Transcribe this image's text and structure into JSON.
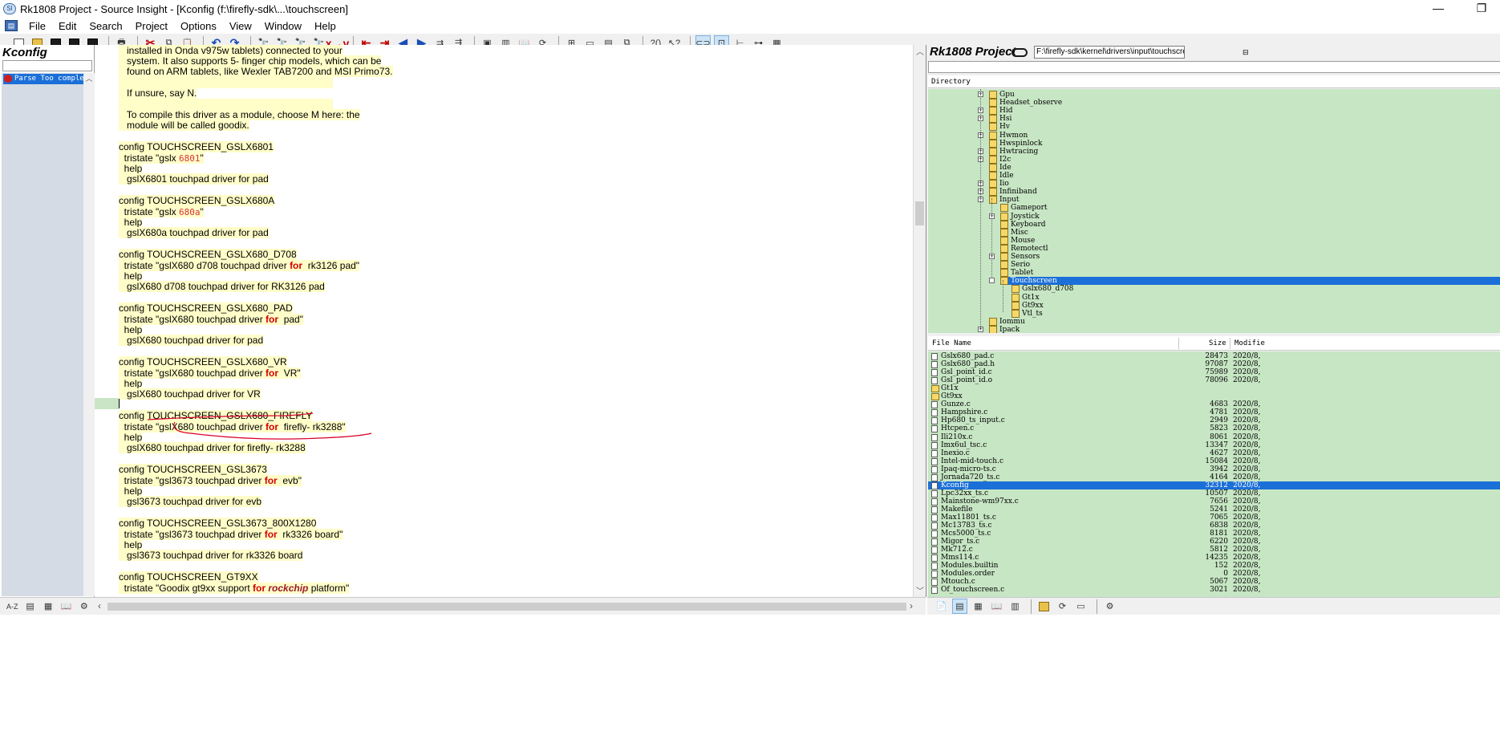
{
  "window": {
    "title": "Rk1808 Project - Source Insight - [Kconfig (f:\\firefly-sdk\\...\\touchscreen]",
    "minimize": "—",
    "restore": "❐"
  },
  "menu": [
    {
      "label": "File"
    },
    {
      "label": "Edit"
    },
    {
      "label": "Search"
    },
    {
      "label": "Project"
    },
    {
      "label": "Options"
    },
    {
      "label": "View"
    },
    {
      "label": "Window"
    },
    {
      "label": "Help"
    }
  ],
  "left_panel": {
    "title": "Kconfig",
    "item": "Parse Too complex"
  },
  "bottom_left": {
    "sort_az": "A-Z"
  },
  "code": [
    {
      "text": "   installed in Onda v975w tablets) connected to your",
      "hl": true
    },
    {
      "text": "   system. It also supports 5- finger chip models, which can be",
      "hl": true
    },
    {
      "text": "   found on ARM tablets, like Wexler TAB7200 and MSI Primo73.",
      "hl": true
    },
    {
      "text": "",
      "hl": true
    },
    {
      "text": "   If unsure, say N.",
      "hl": true
    },
    {
      "text": "",
      "hl": true
    },
    {
      "text": "   To compile this driver as a module, choose M here: the",
      "hl": true
    },
    {
      "text": "   module will be called goodix.",
      "hl": true
    },
    {
      "text": "",
      "hl": false
    },
    {
      "text": "config TOUCHSCREEN_GSLX6801",
      "hl": true
    },
    {
      "text": "  tristate \"gslx ",
      "num": "6801",
      "after": "\"",
      "hl": true
    },
    {
      "text": "  help",
      "hl": true
    },
    {
      "text": "   gslX6801 touchpad driver for pad",
      "hl": true
    },
    {
      "text": "",
      "hl": false
    },
    {
      "text": "config TOUCHSCREEN_GSLX680A",
      "hl": true
    },
    {
      "text": "  tristate \"gslx ",
      "num": "680a",
      "after": "\"",
      "hl": true
    },
    {
      "text": "  help",
      "hl": true
    },
    {
      "text": "   gslX680a touchpad driver for pad",
      "hl": true
    },
    {
      "text": "",
      "hl": false
    },
    {
      "text": "config TOUCHSCREEN_GSLX680_D708",
      "hl": true
    },
    {
      "text": "  tristate \"gslX680 d708 touchpad driver ",
      "kw": "for",
      "after": " rk3126 pad\"",
      "hl": true
    },
    {
      "text": "  help",
      "hl": true
    },
    {
      "text": "   gslX680 d708 touchpad driver for RK3126 pad",
      "hl": true
    },
    {
      "text": "",
      "hl": false
    },
    {
      "text": "config TOUCHSCREEN_GSLX680_PAD",
      "hl": true
    },
    {
      "text": "  tristate \"gslX680 touchpad driver ",
      "kw": "for",
      "after": " pad\"",
      "hl": true
    },
    {
      "text": "  help",
      "hl": true
    },
    {
      "text": "   gslX680 touchpad driver for pad",
      "hl": true
    },
    {
      "text": "",
      "hl": false
    },
    {
      "text": "config TOUCHSCREEN_GSLX680_VR",
      "hl": true
    },
    {
      "text": "  tristate \"gslX680 touchpad driver ",
      "kw": "for",
      "after": " VR\"",
      "hl": true
    },
    {
      "text": "  help",
      "hl": true
    },
    {
      "text": "   gslX680 touchpad driver for VR",
      "hl": true
    },
    {
      "text": "",
      "hl": false
    },
    {
      "text": "config TOUCHSCREEN_GSLX680_FIREFLY",
      "hl": true
    },
    {
      "text": "  tristate \"gslX680 touchpad driver ",
      "kw": "for",
      "after": " firefly- rk3288\"",
      "hl": true
    },
    {
      "text": "  help",
      "hl": true
    },
    {
      "text": "   gslX680 touchpad driver for firefly- rk3288",
      "hl": true
    },
    {
      "text": "",
      "hl": false
    },
    {
      "text": "config TOUCHSCREEN_GSL3673",
      "hl": true
    },
    {
      "text": "  tristate \"gsl3673 touchpad driver ",
      "kw": "for",
      "after": " evb\"",
      "hl": true
    },
    {
      "text": "  help",
      "hl": true
    },
    {
      "text": "   gsl3673 touchpad driver for evb",
      "hl": true
    },
    {
      "text": "",
      "hl": false
    },
    {
      "text": "config TOUCHSCREEN_GSL3673_800X1280",
      "hl": true
    },
    {
      "text": "  tristate \"gsl3673 touchpad driver ",
      "kw": "for",
      "after": " rk3326 board\"",
      "hl": true
    },
    {
      "text": "  help",
      "hl": true
    },
    {
      "text": "   gsl3673 touchpad driver for rk3326 board",
      "hl": true
    },
    {
      "text": "",
      "hl": false
    },
    {
      "text": "config TOUCHSCREEN_GT9XX",
      "hl": true
    },
    {
      "text": "  tristate \"Goodix gt9xx support ",
      "kw": "for",
      "rock": "rockchip",
      "after": " platform\"",
      "hl": true
    }
  ],
  "project": {
    "title": "Rk1808 Project",
    "path": "F:\\firefly-sdk\\kernel\\drivers\\input\\touchscreen",
    "dir_header": "Directory",
    "tree": [
      {
        "label": "Gpu",
        "depth": 0,
        "pm": "+"
      },
      {
        "label": "Headset_observe",
        "depth": 0,
        "pm": ""
      },
      {
        "label": "Hid",
        "depth": 0,
        "pm": "+"
      },
      {
        "label": "Hsi",
        "depth": 0,
        "pm": "+"
      },
      {
        "label": "Hv",
        "depth": 0,
        "pm": ""
      },
      {
        "label": "Hwmon",
        "depth": 0,
        "pm": "+"
      },
      {
        "label": "Hwspinlock",
        "depth": 0,
        "pm": ""
      },
      {
        "label": "Hwtracing",
        "depth": 0,
        "pm": "+"
      },
      {
        "label": "I2c",
        "depth": 0,
        "pm": "+"
      },
      {
        "label": "Ide",
        "depth": 0,
        "pm": ""
      },
      {
        "label": "Idle",
        "depth": 0,
        "pm": ""
      },
      {
        "label": "Iio",
        "depth": 0,
        "pm": "+"
      },
      {
        "label": "Infiniband",
        "depth": 0,
        "pm": "+"
      },
      {
        "label": "Input",
        "depth": 0,
        "pm": "−"
      },
      {
        "label": "Gameport",
        "depth": 1,
        "pm": ""
      },
      {
        "label": "Joystick",
        "depth": 1,
        "pm": "+"
      },
      {
        "label": "Keyboard",
        "depth": 1,
        "pm": ""
      },
      {
        "label": "Misc",
        "depth": 1,
        "pm": ""
      },
      {
        "label": "Mouse",
        "depth": 1,
        "pm": ""
      },
      {
        "label": "Remotectl",
        "depth": 1,
        "pm": ""
      },
      {
        "label": "Sensors",
        "depth": 1,
        "pm": "+"
      },
      {
        "label": "Serio",
        "depth": 1,
        "pm": ""
      },
      {
        "label": "Tablet",
        "depth": 1,
        "pm": ""
      },
      {
        "label": "Touchscreen",
        "depth": 1,
        "pm": "−",
        "selected": true
      },
      {
        "label": "Gslx680_d708",
        "depth": 2,
        "pm": ""
      },
      {
        "label": "Gt1x",
        "depth": 2,
        "pm": ""
      },
      {
        "label": "Gt9xx",
        "depth": 2,
        "pm": ""
      },
      {
        "label": "Vtl_ts",
        "depth": 2,
        "pm": ""
      },
      {
        "label": "Iommu",
        "depth": 0,
        "pm": ""
      },
      {
        "label": "Ipack",
        "depth": 0,
        "pm": "+"
      }
    ],
    "file_header": {
      "name": "File Name",
      "size": "Size",
      "modified": "Modifie"
    },
    "files": [
      {
        "name": "Gslx680_pad.c",
        "size": "28473",
        "date": "2020/8,"
      },
      {
        "name": "Gslx680_pad.h",
        "size": "97087",
        "date": "2020/8,"
      },
      {
        "name": "Gsl_point_id.c",
        "size": "75989",
        "date": "2020/8,"
      },
      {
        "name": "Gsl_point_id.o",
        "size": "78096",
        "date": "2020/8,"
      },
      {
        "name": "Gt1x",
        "size": "",
        "date": "",
        "folder": true
      },
      {
        "name": "Gt9xx",
        "size": "",
        "date": "",
        "folder": true
      },
      {
        "name": "Gunze.c",
        "size": "4683",
        "date": "2020/8,"
      },
      {
        "name": "Hampshire.c",
        "size": "4781",
        "date": "2020/8,"
      },
      {
        "name": "Hp680_ts_input.c",
        "size": "2949",
        "date": "2020/8,"
      },
      {
        "name": "Htcpen.c",
        "size": "5823",
        "date": "2020/8,"
      },
      {
        "name": "Ili210x.c",
        "size": "8061",
        "date": "2020/8,"
      },
      {
        "name": "Imx6ul_tsc.c",
        "size": "13347",
        "date": "2020/8,"
      },
      {
        "name": "Inexio.c",
        "size": "4627",
        "date": "2020/8,"
      },
      {
        "name": "Intel-mid-touch.c",
        "size": "15084",
        "date": "2020/8,"
      },
      {
        "name": "Ipaq-micro-ts.c",
        "size": "3942",
        "date": "2020/8,"
      },
      {
        "name": "Jornada720_ts.c",
        "size": "4164",
        "date": "2020/8,"
      },
      {
        "name": "Kconfig",
        "size": "32312",
        "date": "2020/8,",
        "selected": true
      },
      {
        "name": "Lpc32xx_ts.c",
        "size": "10507",
        "date": "2020/8,"
      },
      {
        "name": "Mainstone-wm97xx.c",
        "size": "7656",
        "date": "2020/8,"
      },
      {
        "name": "Makefile",
        "size": "5241",
        "date": "2020/8,"
      },
      {
        "name": "Max11801_ts.c",
        "size": "7065",
        "date": "2020/8,"
      },
      {
        "name": "Mc13783_ts.c",
        "size": "6838",
        "date": "2020/8,"
      },
      {
        "name": "Mcs5000_ts.c",
        "size": "8181",
        "date": "2020/8,"
      },
      {
        "name": "Migor_ts.c",
        "size": "6220",
        "date": "2020/8,"
      },
      {
        "name": "Mk712.c",
        "size": "5812",
        "date": "2020/8,"
      },
      {
        "name": "Mms114.c",
        "size": "14235",
        "date": "2020/8,"
      },
      {
        "name": "Modules.builtin",
        "size": "152",
        "date": "2020/8,"
      },
      {
        "name": "Modules.order",
        "size": "0",
        "date": "2020/8,"
      },
      {
        "name": "Mtouch.c",
        "size": "5067",
        "date": "2020/8,"
      },
      {
        "name": "Of_touchscreen.c",
        "size": "3021",
        "date": "2020/8,"
      }
    ]
  },
  "colors": {
    "highlight": "#fffdc8",
    "tree_bg": "#c7e6c4",
    "selection": "#1b6fd8",
    "keyword_for": "#d40000",
    "annotation_red": "#d8002a"
  }
}
